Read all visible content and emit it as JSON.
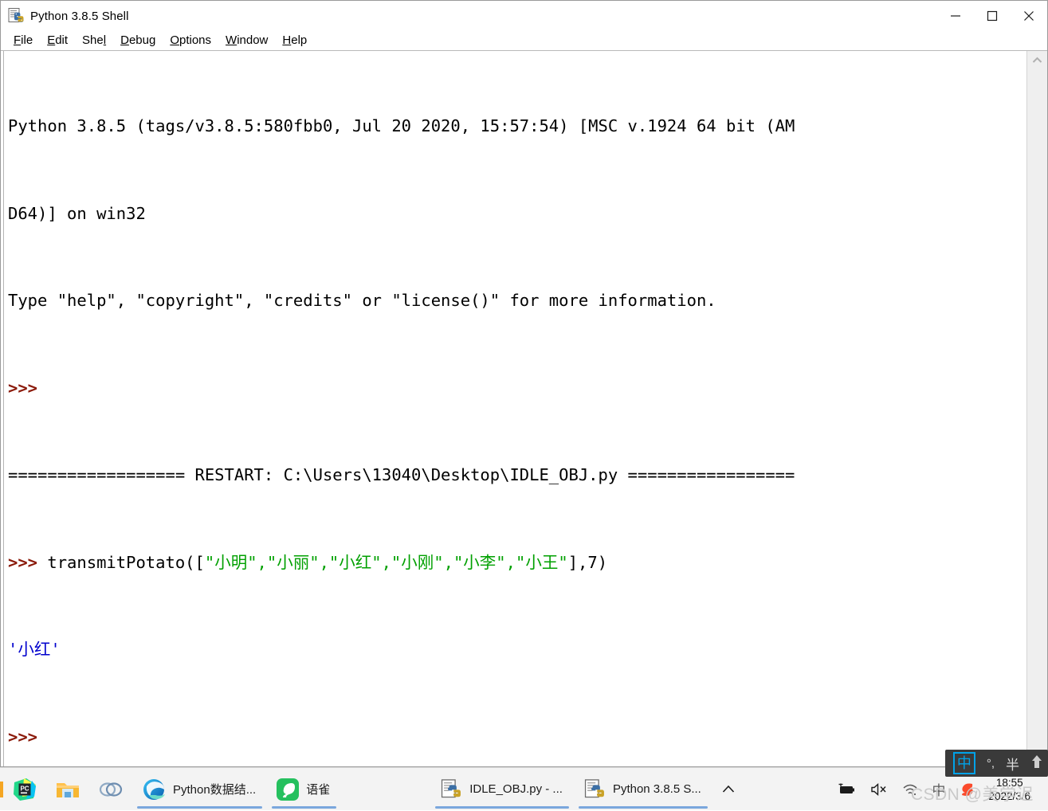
{
  "window": {
    "title": "Python 3.8.5 Shell",
    "icon": "python-idle-icon",
    "controls": {
      "minimize": "minimize-button",
      "maximize": "maximize-button",
      "close": "close-button"
    }
  },
  "menu": {
    "items": [
      {
        "label": "File",
        "accel": "F"
      },
      {
        "label": "Edit",
        "accel": "E"
      },
      {
        "label": "Shell",
        "accel": "l"
      },
      {
        "label": "Debug",
        "accel": "D"
      },
      {
        "label": "Options",
        "accel": "O"
      },
      {
        "label": "Window",
        "accel": "W"
      },
      {
        "label": "Help",
        "accel": "H"
      }
    ]
  },
  "console": {
    "line1": "Python 3.8.5 (tags/v3.8.5:580fbb0, Jul 20 2020, 15:57:54) [MSC v.1924 64 bit (AM",
    "line2": "D64)] on win32",
    "line3": "Type \"help\", \"copyright\", \"credits\" or \"license()\" for more information.",
    "prompt1": ">>> ",
    "restart": "================== RESTART: C:\\Users\\13040\\Desktop\\IDLE_OBJ.py =================",
    "prompt2": ">>> ",
    "command_head": "transmitPotato([",
    "command_args": "\"小明\",\"小丽\",\"小红\",\"小刚\",\"小李\",\"小王\"",
    "command_tail": "],7)",
    "output": "'小红'",
    "prompt3": ">>> ",
    "colors": {
      "prompt": "#8b1a0a",
      "string": "#00a000",
      "output": "#0000cd",
      "text": "#000000",
      "background": "#ffffff"
    }
  },
  "scrollbar": {
    "up_arrow": "chevron-up-icon"
  },
  "taskbar": {
    "pinned": [
      {
        "name": "pycharm-icon",
        "label": "PyCharm"
      },
      {
        "name": "file-explorer-icon",
        "label": "File Explorer"
      },
      {
        "name": "rings-icon",
        "label": "Rings"
      }
    ],
    "tasks": [
      {
        "name": "edge",
        "label": "Python数据结...",
        "icon": "edge-icon",
        "active": true
      },
      {
        "name": "yuque",
        "label": "语雀",
        "icon": "yuque-icon",
        "active": true
      },
      {
        "name": "idle-editor",
        "label": "IDLE_OBJ.py - ...",
        "icon": "python-idle-icon",
        "active": true
      },
      {
        "name": "idle-shell",
        "label": "Python 3.8.5 S...",
        "icon": "python-idle-icon",
        "active": true
      }
    ],
    "overflow": "^",
    "tray": [
      {
        "name": "battery-charging-icon",
        "glyph": "battery"
      },
      {
        "name": "speaker-muted-icon",
        "glyph": "mute"
      },
      {
        "name": "wifi-icon",
        "glyph": "wifi"
      },
      {
        "name": "ime-chinese-icon",
        "glyph": "中"
      },
      {
        "name": "sogou-icon",
        "glyph": "S"
      }
    ],
    "clock": {
      "time": "18:55",
      "date": "2022/3/6"
    }
  },
  "ime_bar": {
    "mode": "中",
    "punctuation": "°,",
    "width_mode": "半",
    "expand": "⬆"
  },
  "watermark": {
    "text": "CSDN @美学迟"
  }
}
